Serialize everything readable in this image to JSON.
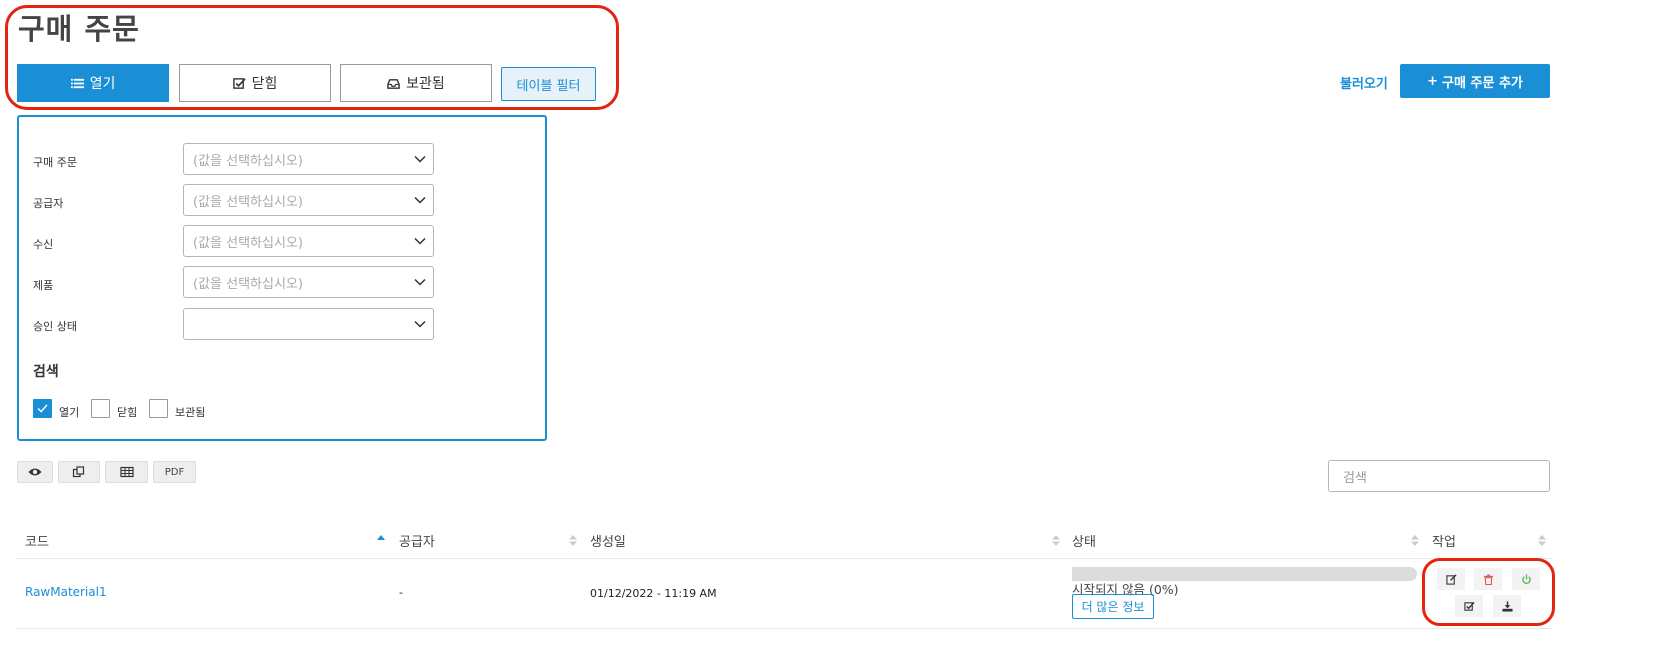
{
  "page": {
    "title": "구매 주문"
  },
  "tabs": [
    {
      "label": "열기",
      "icon": "list-icon",
      "active": true
    },
    {
      "label": "닫힘",
      "icon": "check-square-icon",
      "active": false
    },
    {
      "label": "보관됨",
      "icon": "inbox-icon",
      "active": false
    }
  ],
  "filter_toggle": {
    "label": "테이블 필터"
  },
  "header_actions": {
    "import_label": "불러오기",
    "add_label": "구매 주문 추가"
  },
  "filters": {
    "fields": [
      {
        "label": "구매 주문",
        "placeholder": "(값을 선택하십시오)"
      },
      {
        "label": "공급자",
        "placeholder": "(값을 선택하십시오)"
      },
      {
        "label": "수신",
        "placeholder": "(값을 선택하십시오)"
      },
      {
        "label": "제품",
        "placeholder": "(값을 선택하십시오)"
      },
      {
        "label": "승인 상태",
        "placeholder": ""
      }
    ],
    "search_heading": "검색",
    "checkboxes": [
      {
        "label": "열기",
        "checked": true
      },
      {
        "label": "닫힘",
        "checked": false
      },
      {
        "label": "보관됨",
        "checked": false
      }
    ]
  },
  "toolbar": {
    "pdf_label": "PDF",
    "icons": [
      "eye-icon",
      "copy-icon",
      "table-icon"
    ]
  },
  "search": {
    "placeholder": "검색"
  },
  "table": {
    "columns": [
      "코드",
      "공급자",
      "생성일",
      "상태",
      "작업"
    ],
    "rows": [
      {
        "code": "RawMaterial1",
        "supplier": "-",
        "created": "01/12/2022 - 11:19 AM",
        "status": "시작되지 않음 (0%)",
        "progress": 0,
        "more_info": "더 많은 정보"
      }
    ]
  },
  "colors": {
    "accent": "#1a8fd6",
    "delete": "#e05555",
    "power": "#5cb85c",
    "annotation": "#e3250f"
  }
}
